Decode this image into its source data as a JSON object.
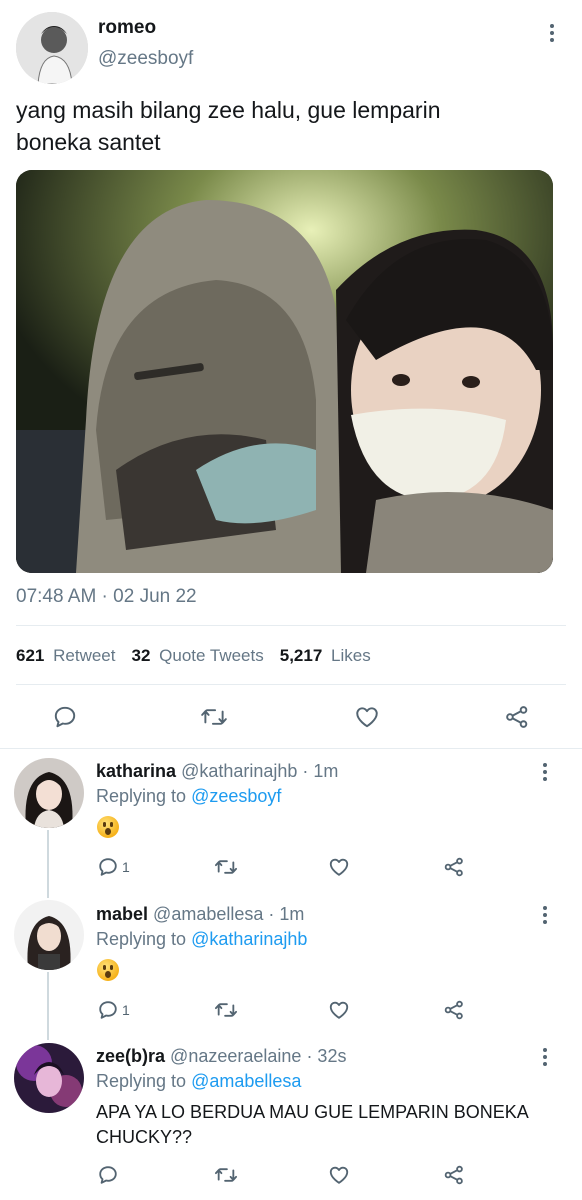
{
  "tweet": {
    "display_name": "romeo",
    "handle": "@zeesboyf",
    "text_line1": "yang masih bilang zee halu, gue lemparin",
    "text_line2": "boneka santet",
    "timestamp": "07:48 AM · 02 Jun 22",
    "stats": {
      "retweets_count": "621",
      "retweets_label": "Retweet",
      "quotes_count": "32",
      "quotes_label": "Quote Tweets",
      "likes_count": "5,217",
      "likes_label": "Likes"
    }
  },
  "replies": [
    {
      "display_name": "katharina",
      "handle": "@katharinajhb",
      "age": "· 1m",
      "replying_prefix": "Replying to",
      "replying_to": "@zeesboyf",
      "reply_count": "1"
    },
    {
      "display_name": "mabel",
      "handle": "@amabellesa",
      "age": "· 1m",
      "replying_prefix": "Replying to",
      "replying_to": "@katharinajhb",
      "reply_count": "1"
    },
    {
      "display_name": "zee(b)ra",
      "handle": "@nazeeraelaine",
      "age": "· 32s",
      "replying_prefix": "Replying to",
      "replying_to": "@amabellesa",
      "text_line1": "APA YA LO BERDUA MAU GUE LEMPARIN BONEKA",
      "text_line2": "CHUCKY??"
    }
  ],
  "colors": {
    "link": "#1d9bf0",
    "muted": "#657786",
    "icon": "#536471",
    "divider": "#e6ecf0"
  }
}
